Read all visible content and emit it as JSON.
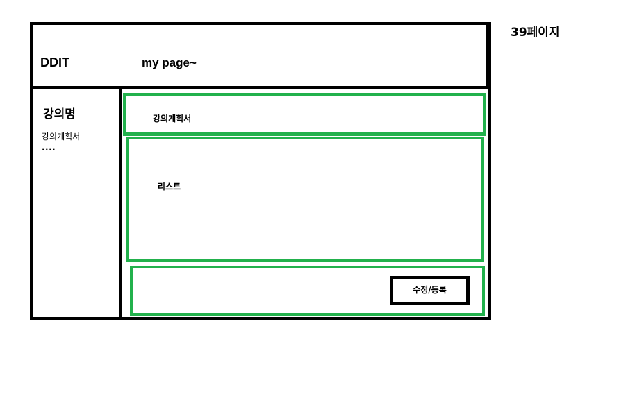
{
  "page_number": "39페이지",
  "header": {
    "brand": "DDIT",
    "title": "my page~"
  },
  "sidebar": {
    "course_name": "강의명",
    "items": [
      {
        "label": "강의계획서"
      },
      {
        "label": "...."
      }
    ]
  },
  "main": {
    "section_title": "강의계획서",
    "list_label": "리스트",
    "submit_button": "수정/등록"
  },
  "colors": {
    "border": "#000000",
    "section_outline": "#22b14c"
  }
}
